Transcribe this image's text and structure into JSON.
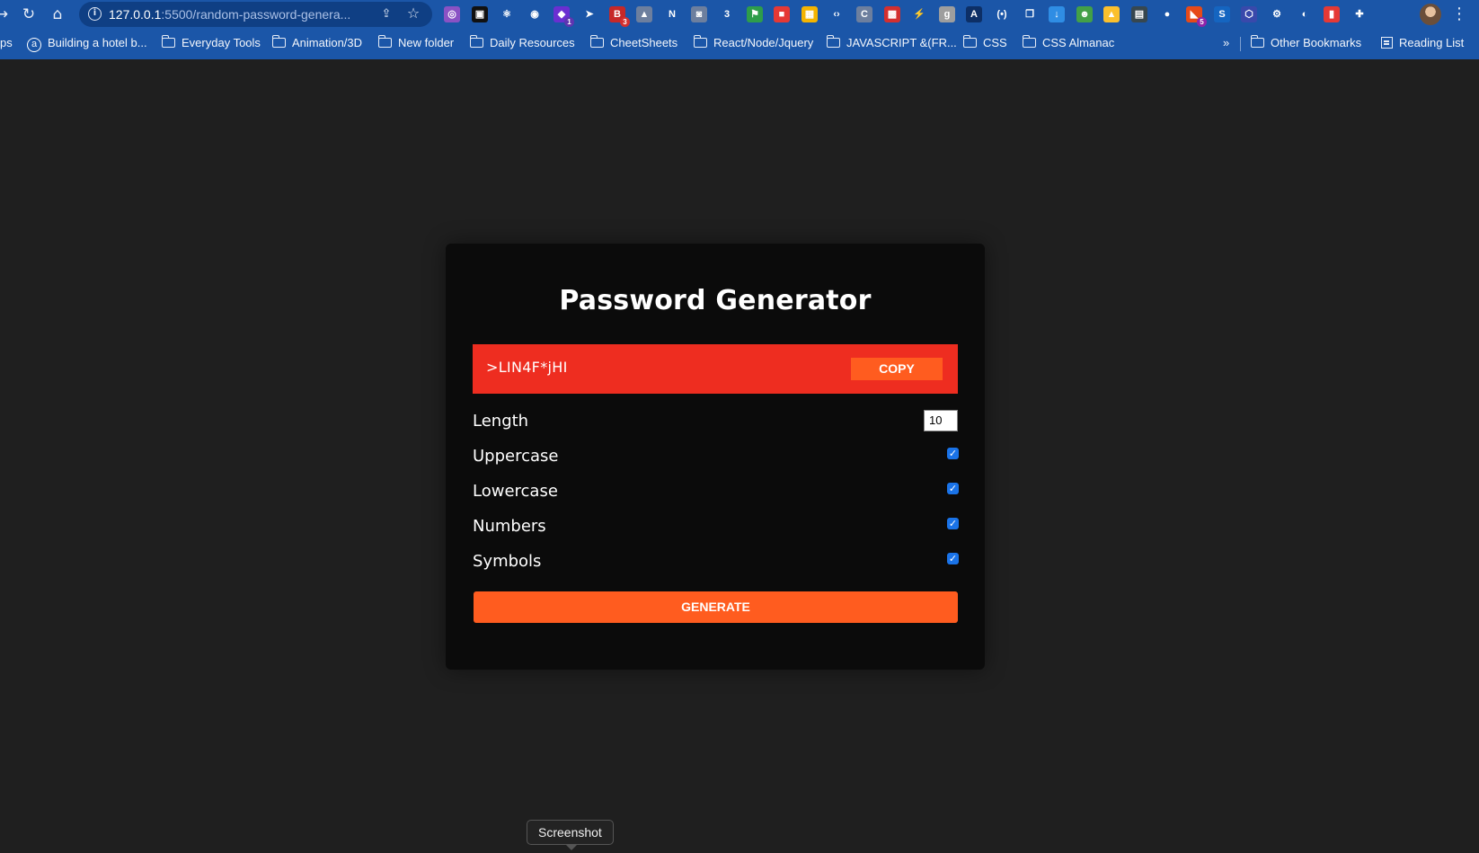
{
  "browser": {
    "url_host": "127.0.0.1",
    "url_rest": ":5500/random-password-genera...",
    "extensions": [
      {
        "name": "ext-1",
        "glyph": "◎",
        "color": "#8a52c4"
      },
      {
        "name": "ext-2",
        "glyph": "▣",
        "color": "#111111"
      },
      {
        "name": "ext-3",
        "glyph": "⚛",
        "color": "#1b56a8"
      },
      {
        "name": "ext-4",
        "glyph": "◉",
        "color": "#1b56a8"
      },
      {
        "name": "ext-5",
        "glyph": "◆",
        "color": "#6a2fd1",
        "badge": "1"
      },
      {
        "name": "ext-6",
        "glyph": "➤",
        "color": "#1b56a8"
      },
      {
        "name": "ext-7",
        "glyph": "B",
        "color": "#c62828",
        "badge": "3"
      },
      {
        "name": "ext-8",
        "glyph": "▲",
        "color": "#6d7f9e"
      },
      {
        "name": "ext-9",
        "glyph": "N",
        "color": "#1b56a8"
      },
      {
        "name": "ext-10",
        "glyph": "◙",
        "color": "#6d7f9e"
      },
      {
        "name": "ext-11",
        "glyph": "3",
        "color": "#1b56a8"
      },
      {
        "name": "ext-12",
        "glyph": "⚑",
        "color": "#2e9d4a"
      },
      {
        "name": "ext-13",
        "glyph": "■",
        "color": "#e53935"
      },
      {
        "name": "ext-14",
        "glyph": "▦",
        "color": "#f4b400"
      },
      {
        "name": "ext-15",
        "glyph": "‹›",
        "color": "#1b56a8"
      },
      {
        "name": "ext-16",
        "glyph": "C",
        "color": "#6d7f9e"
      },
      {
        "name": "ext-17",
        "glyph": "▩",
        "color": "#d32f2f"
      },
      {
        "name": "ext-18",
        "glyph": "⚡",
        "color": "#1b56a8"
      },
      {
        "name": "ext-19",
        "glyph": "g",
        "color": "#9e9e9e"
      },
      {
        "name": "ext-20",
        "glyph": "A",
        "color": "#0d2f66"
      },
      {
        "name": "ext-21",
        "glyph": "(•)",
        "color": "#1b56a8"
      },
      {
        "name": "ext-22",
        "glyph": "❐",
        "color": "#1b56a8"
      },
      {
        "name": "ext-23",
        "glyph": "↓",
        "color": "#2f8de4"
      },
      {
        "name": "ext-24",
        "glyph": "☻",
        "color": "#43a047"
      },
      {
        "name": "ext-25",
        "glyph": "▲",
        "color": "#fbc02d"
      },
      {
        "name": "ext-26",
        "glyph": "▤",
        "color": "#37474f"
      },
      {
        "name": "ext-27",
        "glyph": "●",
        "color": "#1b56a8"
      },
      {
        "name": "ext-28",
        "glyph": "◣",
        "color": "#e64a19",
        "badge": "5"
      },
      {
        "name": "ext-29",
        "glyph": "S",
        "color": "#1565c0"
      },
      {
        "name": "ext-30",
        "glyph": "⬡",
        "color": "#3949ab"
      },
      {
        "name": "ext-31",
        "glyph": "⚙",
        "color": "#1b56a8"
      },
      {
        "name": "ext-32",
        "glyph": "◐",
        "color": "#1b56a8"
      },
      {
        "name": "ext-33",
        "glyph": "▮",
        "color": "#e53935"
      },
      {
        "name": "ext-34",
        "glyph": "✚",
        "color": "#1b56a8"
      }
    ],
    "bookmarks": [
      {
        "label": "ps",
        "type": "text"
      },
      {
        "label": "Building a hotel b...",
        "type": "amazon"
      },
      {
        "label": "Everyday Tools",
        "type": "folder"
      },
      {
        "label": "Animation/3D",
        "type": "folder"
      },
      {
        "label": "New folder",
        "type": "folder"
      },
      {
        "label": "Daily  Resources",
        "type": "folder"
      },
      {
        "label": "CheetSheets",
        "type": "folder"
      },
      {
        "label": "React/Node/Jquery",
        "type": "folder"
      },
      {
        "label": "JAVASCRIPT &(FR...",
        "type": "folder"
      },
      {
        "label": "CSS",
        "type": "folder"
      },
      {
        "label": "CSS Almanac",
        "type": "folder"
      }
    ],
    "overflow_label": "»",
    "other_bookmarks": "Other Bookmarks",
    "reading_list": "Reading List"
  },
  "app": {
    "title": "Password Generator",
    "password": ">LIN4F*jHI",
    "copy_label": "COPY",
    "length_label": "Length",
    "length_value": "10",
    "options": [
      {
        "label": "Uppercase",
        "checked": true
      },
      {
        "label": "Lowercase",
        "checked": true
      },
      {
        "label": "Numbers",
        "checked": true
      },
      {
        "label": "Symbols",
        "checked": true
      }
    ],
    "generate_label": "GENERATE"
  },
  "tooltip": {
    "text": "Screenshot"
  },
  "colors": {
    "page_bg": "#1f1f1f",
    "card_bg": "#0b0b0b",
    "result_bg": "#ee2d20",
    "button": "#ff5c1f",
    "checkbox": "#1a73e8",
    "browser_toolbar": "#1b56a8"
  }
}
